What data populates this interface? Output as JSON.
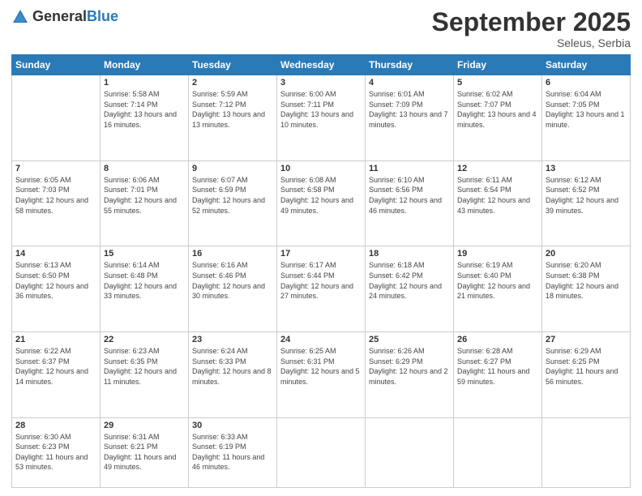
{
  "header": {
    "logo_general": "General",
    "logo_blue": "Blue",
    "title": "September 2025",
    "location": "Seleus, Serbia"
  },
  "columns": [
    "Sunday",
    "Monday",
    "Tuesday",
    "Wednesday",
    "Thursday",
    "Friday",
    "Saturday"
  ],
  "weeks": [
    [
      {
        "day": "",
        "info": ""
      },
      {
        "day": "1",
        "info": "Sunrise: 5:58 AM\nSunset: 7:14 PM\nDaylight: 13 hours and 16 minutes."
      },
      {
        "day": "2",
        "info": "Sunrise: 5:59 AM\nSunset: 7:12 PM\nDaylight: 13 hours and 13 minutes."
      },
      {
        "day": "3",
        "info": "Sunrise: 6:00 AM\nSunset: 7:11 PM\nDaylight: 13 hours and 10 minutes."
      },
      {
        "day": "4",
        "info": "Sunrise: 6:01 AM\nSunset: 7:09 PM\nDaylight: 13 hours and 7 minutes."
      },
      {
        "day": "5",
        "info": "Sunrise: 6:02 AM\nSunset: 7:07 PM\nDaylight: 13 hours and 4 minutes."
      },
      {
        "day": "6",
        "info": "Sunrise: 6:04 AM\nSunset: 7:05 PM\nDaylight: 13 hours and 1 minute."
      }
    ],
    [
      {
        "day": "7",
        "info": "Sunrise: 6:05 AM\nSunset: 7:03 PM\nDaylight: 12 hours and 58 minutes."
      },
      {
        "day": "8",
        "info": "Sunrise: 6:06 AM\nSunset: 7:01 PM\nDaylight: 12 hours and 55 minutes."
      },
      {
        "day": "9",
        "info": "Sunrise: 6:07 AM\nSunset: 6:59 PM\nDaylight: 12 hours and 52 minutes."
      },
      {
        "day": "10",
        "info": "Sunrise: 6:08 AM\nSunset: 6:58 PM\nDaylight: 12 hours and 49 minutes."
      },
      {
        "day": "11",
        "info": "Sunrise: 6:10 AM\nSunset: 6:56 PM\nDaylight: 12 hours and 46 minutes."
      },
      {
        "day": "12",
        "info": "Sunrise: 6:11 AM\nSunset: 6:54 PM\nDaylight: 12 hours and 43 minutes."
      },
      {
        "day": "13",
        "info": "Sunrise: 6:12 AM\nSunset: 6:52 PM\nDaylight: 12 hours and 39 minutes."
      }
    ],
    [
      {
        "day": "14",
        "info": "Sunrise: 6:13 AM\nSunset: 6:50 PM\nDaylight: 12 hours and 36 minutes."
      },
      {
        "day": "15",
        "info": "Sunrise: 6:14 AM\nSunset: 6:48 PM\nDaylight: 12 hours and 33 minutes."
      },
      {
        "day": "16",
        "info": "Sunrise: 6:16 AM\nSunset: 6:46 PM\nDaylight: 12 hours and 30 minutes."
      },
      {
        "day": "17",
        "info": "Sunrise: 6:17 AM\nSunset: 6:44 PM\nDaylight: 12 hours and 27 minutes."
      },
      {
        "day": "18",
        "info": "Sunrise: 6:18 AM\nSunset: 6:42 PM\nDaylight: 12 hours and 24 minutes."
      },
      {
        "day": "19",
        "info": "Sunrise: 6:19 AM\nSunset: 6:40 PM\nDaylight: 12 hours and 21 minutes."
      },
      {
        "day": "20",
        "info": "Sunrise: 6:20 AM\nSunset: 6:38 PM\nDaylight: 12 hours and 18 minutes."
      }
    ],
    [
      {
        "day": "21",
        "info": "Sunrise: 6:22 AM\nSunset: 6:37 PM\nDaylight: 12 hours and 14 minutes."
      },
      {
        "day": "22",
        "info": "Sunrise: 6:23 AM\nSunset: 6:35 PM\nDaylight: 12 hours and 11 minutes."
      },
      {
        "day": "23",
        "info": "Sunrise: 6:24 AM\nSunset: 6:33 PM\nDaylight: 12 hours and 8 minutes."
      },
      {
        "day": "24",
        "info": "Sunrise: 6:25 AM\nSunset: 6:31 PM\nDaylight: 12 hours and 5 minutes."
      },
      {
        "day": "25",
        "info": "Sunrise: 6:26 AM\nSunset: 6:29 PM\nDaylight: 12 hours and 2 minutes."
      },
      {
        "day": "26",
        "info": "Sunrise: 6:28 AM\nSunset: 6:27 PM\nDaylight: 11 hours and 59 minutes."
      },
      {
        "day": "27",
        "info": "Sunrise: 6:29 AM\nSunset: 6:25 PM\nDaylight: 11 hours and 56 minutes."
      }
    ],
    [
      {
        "day": "28",
        "info": "Sunrise: 6:30 AM\nSunset: 6:23 PM\nDaylight: 11 hours and 53 minutes."
      },
      {
        "day": "29",
        "info": "Sunrise: 6:31 AM\nSunset: 6:21 PM\nDaylight: 11 hours and 49 minutes."
      },
      {
        "day": "30",
        "info": "Sunrise: 6:33 AM\nSunset: 6:19 PM\nDaylight: 11 hours and 46 minutes."
      },
      {
        "day": "",
        "info": ""
      },
      {
        "day": "",
        "info": ""
      },
      {
        "day": "",
        "info": ""
      },
      {
        "day": "",
        "info": ""
      }
    ]
  ]
}
